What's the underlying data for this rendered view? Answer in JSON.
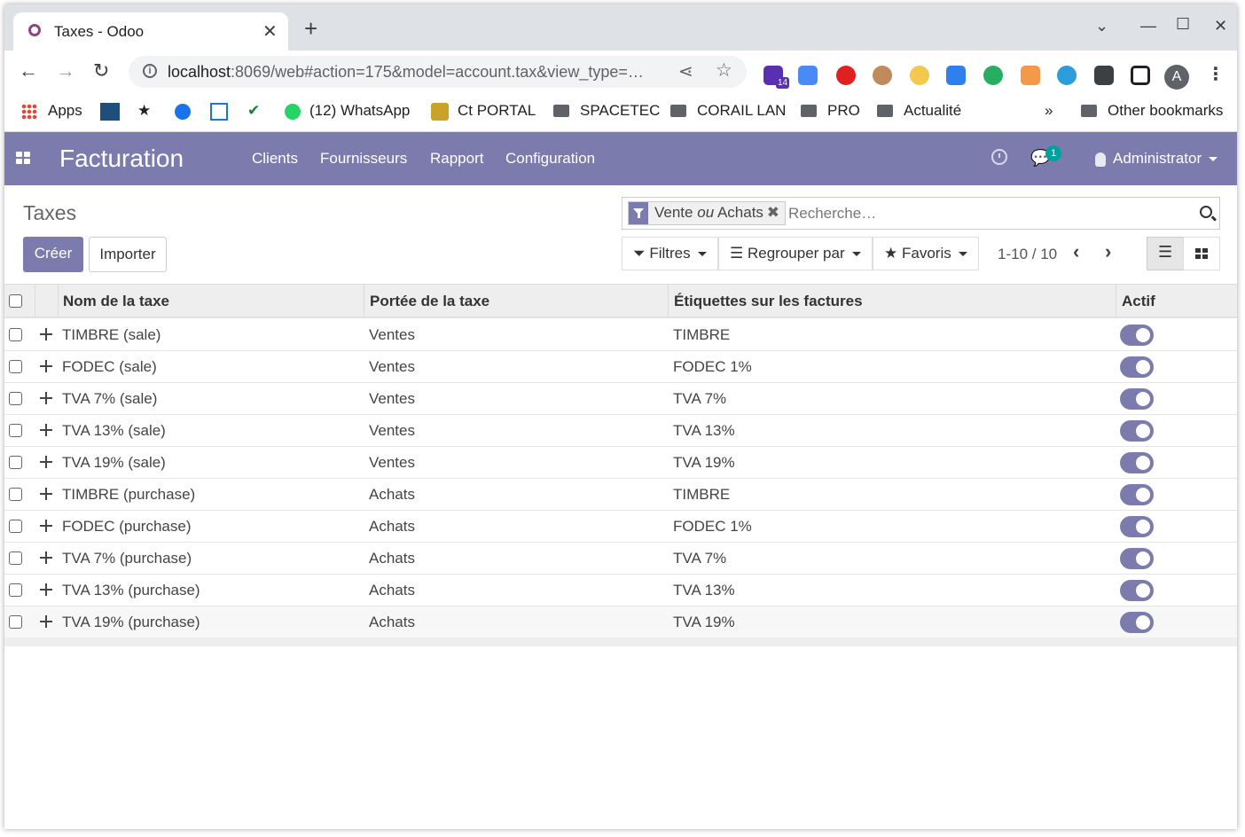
{
  "browser": {
    "tab_title": "Taxes - Odoo",
    "url_host": "localhost",
    "url_rest": ":8069/web#action=175&model=account.tax&view_type=…",
    "extension_badge": "14",
    "profile_initial": "A",
    "bookmarks": {
      "apps": "Apps",
      "whatsapp": "(12) WhatsApp",
      "ct_portal": "Ct PORTAL",
      "spacetec": "SPACETEC",
      "corail_lan": "CORAIL LAN",
      "pro": "PRO",
      "actualite": "Actualité",
      "more": "»",
      "other": "Other bookmarks"
    }
  },
  "odoo_nav": {
    "brand": "Facturation",
    "menu": [
      "Clients",
      "Fournisseurs",
      "Rapport",
      "Configuration"
    ],
    "chat_count": "1",
    "user": "Administrator"
  },
  "control_panel": {
    "breadcrumb": "Taxes",
    "create_label": "Créer",
    "import_label": "Importer",
    "facet_part1": "Vente",
    "facet_or": "ou",
    "facet_part2": "Achats",
    "search_placeholder": "Recherche…",
    "filters_label": "Filtres",
    "groupby_label": "Regrouper par",
    "favorites_label": "Favoris",
    "pager": "1-10 / 10"
  },
  "table": {
    "headers": {
      "name": "Nom de la taxe",
      "scope": "Portée de la taxe",
      "labels": "Étiquettes sur les factures",
      "active": "Actif"
    },
    "rows": [
      {
        "name": "TIMBRE (sale)",
        "scope": "Ventes",
        "label": "TIMBRE",
        "active": true
      },
      {
        "name": "FODEC (sale)",
        "scope": "Ventes",
        "label": "FODEC 1%",
        "active": true
      },
      {
        "name": "TVA 7% (sale)",
        "scope": "Ventes",
        "label": "TVA 7%",
        "active": true
      },
      {
        "name": "TVA 13% (sale)",
        "scope": "Ventes",
        "label": "TVA 13%",
        "active": true
      },
      {
        "name": "TVA 19% (sale)",
        "scope": "Ventes",
        "label": "TVA 19%",
        "active": true
      },
      {
        "name": "TIMBRE (purchase)",
        "scope": "Achats",
        "label": "TIMBRE",
        "active": true
      },
      {
        "name": "FODEC (purchase)",
        "scope": "Achats",
        "label": "FODEC 1%",
        "active": true
      },
      {
        "name": "TVA 7% (purchase)",
        "scope": "Achats",
        "label": "TVA 7%",
        "active": true
      },
      {
        "name": "TVA 13% (purchase)",
        "scope": "Achats",
        "label": "TVA 13%",
        "active": true
      },
      {
        "name": "TVA 19% (purchase)",
        "scope": "Achats",
        "label": "TVA 19%",
        "active": true
      }
    ]
  },
  "colors": {
    "odoo_primary": "#7c7bad",
    "chat_badge": "#00a09d",
    "tab_strip": "#dee1e6"
  }
}
